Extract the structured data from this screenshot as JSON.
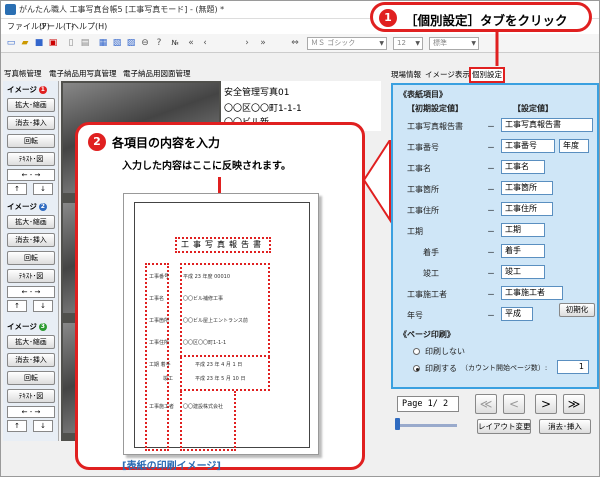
{
  "window": {
    "title": "がんたん職人 工事写真台帳5 [工事写真モード] - (無題) *"
  },
  "menu": [
    "ファイル(F)",
    "ツール(T)",
    "ヘルプ(H)"
  ],
  "toolbar": {
    "font_combo": "ＭＳ ゴシック",
    "size_combo": "12",
    "style_combo": "標準",
    "icons": [
      "new-icon",
      "open-icon",
      "save-icon",
      "print-icon",
      "cut-icon",
      "copy-icon",
      "paste-icon",
      "undo-icon",
      "no-icon",
      "first-icon",
      "prev-icon",
      "next-icon",
      "last-icon",
      "swap-icon"
    ]
  },
  "left_tabs": [
    "写真帳管理",
    "電子納品用写真管理",
    "電子納品用図面管理"
  ],
  "left_pane": {
    "blocks": [
      {
        "label": "イメージ",
        "badge": "1",
        "badge_color": "#e02020"
      },
      {
        "label": "イメージ",
        "badge": "2",
        "badge_color": "#2f6bc0"
      },
      {
        "label": "イメージ",
        "badge": "3",
        "badge_color": "#2a9a30"
      }
    ],
    "buttons": [
      "拡大･縮画",
      "消去･挿入",
      "回転",
      "ﾃｷｽﾄ･図"
    ],
    "arrows": [
      "←",
      "→",
      "↑",
      "↓"
    ]
  },
  "mid_text": {
    "line1": "安全管理写真01",
    "line2": "〇〇区〇〇町1-1-1",
    "line3": "〇〇ビル新"
  },
  "right_tabs": [
    "現場情報",
    "イメージ表示",
    "個別設定"
  ],
  "right_panel": {
    "section_title": "《表紙項目》",
    "col_initial": "【初期設定値】",
    "col_setting": "【設定値】",
    "rows": [
      {
        "label": "工事写真報告書",
        "value": "工事写真報告書"
      },
      {
        "label": "工事番号",
        "value": "工事番号",
        "extra": "年度"
      },
      {
        "label": "工事名",
        "value": "工事名"
      },
      {
        "label": "工事箇所",
        "value": "工事箇所"
      },
      {
        "label": "工事住所",
        "value": "工事住所"
      },
      {
        "label": "工期",
        "value": "工期"
      },
      {
        "label": "着手",
        "value": "着手"
      },
      {
        "label": "竣工",
        "value": "竣工"
      },
      {
        "label": "工事施工者",
        "value": "工事施工者"
      },
      {
        "label": "年号",
        "value": "平成"
      }
    ],
    "dash": "－",
    "reset_button": "初期化",
    "print_section": "《ページ印刷》",
    "radio_no_print": "印刷しない",
    "radio_print": "印刷する",
    "count_label": "（カウント開始ページ数）:",
    "count_value": "1"
  },
  "nav": {
    "page_indicator": "Page 1/ 2",
    "first": "≪",
    "prev": "<",
    "next": ">",
    "last": "≫",
    "layout_button": "レイアウト変更",
    "erase_insert_button": "消去･挿入"
  },
  "callout1": {
    "number": "1",
    "text": "［個別設定］タブをクリック"
  },
  "callout2": {
    "number": "2",
    "text": "各項目の内容を入力",
    "subtext": "入力した内容はここに反映されます。",
    "doc_title": "工事写真報告書",
    "doc_rows": [
      {
        "label": "工事番号",
        "value": "平成 23 年度 00010"
      },
      {
        "label": "工事名",
        "value": "〇〇ビル補修工事"
      },
      {
        "label": "工事箇所",
        "value": "〇〇ビル屋上エントランス前"
      },
      {
        "label": "工事住所",
        "value": "〇〇区〇〇町1-1-1"
      },
      {
        "label": "工期 着手",
        "value": "平成 23 年 4 月 1 日"
      },
      {
        "label": "竣工",
        "value": "平成 23 年 5 月 10 日"
      },
      {
        "label": "工事施工者",
        "value": "〇〇建設株式会社"
      }
    ],
    "caption": "[表紙の印刷イメージ]"
  }
}
